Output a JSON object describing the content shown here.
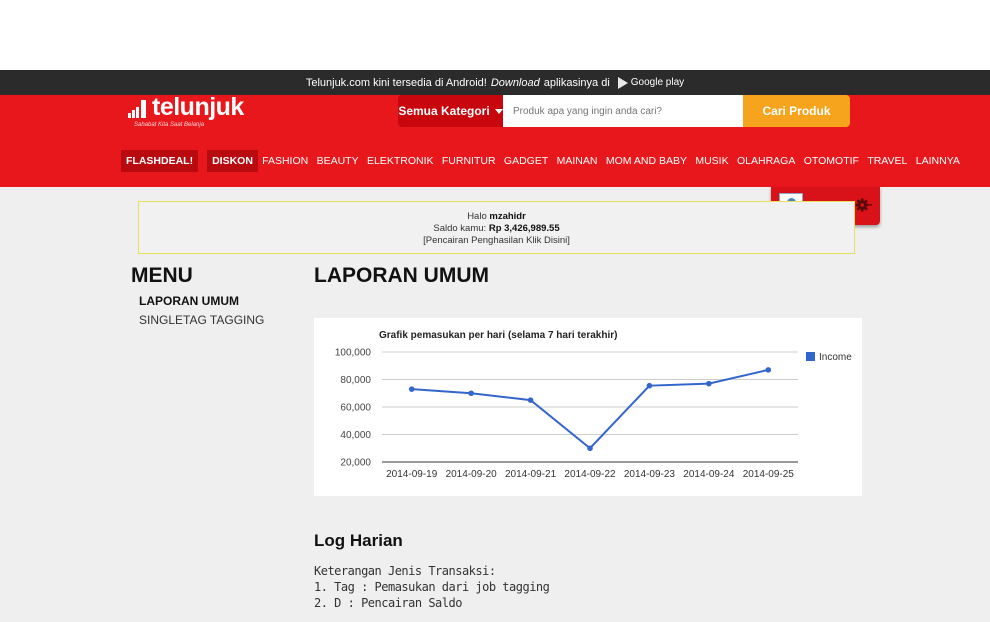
{
  "announcement": {
    "text_before": "Telunjuk.com kini tersedia di Android!",
    "text_em": "Download",
    "text_after": "aplikasinya di",
    "store_label": "Google play"
  },
  "header": {
    "logo_text": "telunjuk",
    "logo_tagline": "Sahabat Kita Saat Belanja",
    "category_button": "Semua Kategori",
    "search_placeholder": "Produk apa yang ingin anda cari?",
    "search_button": "Cari Produk"
  },
  "nav": {
    "flashdeal": "FLASHDEAL!",
    "diskon": "DISKON",
    "items": [
      "FASHION",
      "BEAUTY",
      "ELEKTRONIK",
      "FURNITUR",
      "GADGET",
      "MAINAN",
      "MOM AND BABY",
      "MUSIK",
      "OLAHRAGA",
      "OTOMOTIF",
      "TRAVEL",
      "LAINNYA"
    ]
  },
  "user": {
    "name": "mzahidr"
  },
  "greeting": {
    "halo": "Halo",
    "username": "mzahidr",
    "saldo_label": "Saldo kamu:",
    "saldo_value": "Rp 3,426,989.55",
    "link": "[Pencairan Penghasilan Klik Disini]"
  },
  "menu": {
    "title": "MENU",
    "items": [
      "LAPORAN UMUM",
      "SINGLETAG TAGGING"
    ]
  },
  "page": {
    "title": "LAPORAN UMUM"
  },
  "chart_data": {
    "type": "line",
    "title": "Grafik pemasukan per hari (selama 7 hari terakhir)",
    "categories": [
      "2014-09-19",
      "2014-09-20",
      "2014-09-21",
      "2014-09-22",
      "2014-09-23",
      "2014-09-24",
      "2014-09-25"
    ],
    "series": [
      {
        "name": "Income",
        "values": [
          73000,
          70000,
          65000,
          30000,
          75500,
          77000,
          87000
        ]
      }
    ],
    "yticks": [
      "100,000",
      "80,000",
      "60,000",
      "40,000",
      "20,000"
    ],
    "ylim": [
      20000,
      100000
    ],
    "grid": true,
    "legend": "right",
    "color": "#3366cc"
  },
  "log": {
    "title": "Log Harian",
    "lines": [
      "Keterangan Jenis Transaksi:",
      "1. Tag : Pemasukan dari job tagging",
      "2. D : Pencairan Saldo"
    ]
  }
}
